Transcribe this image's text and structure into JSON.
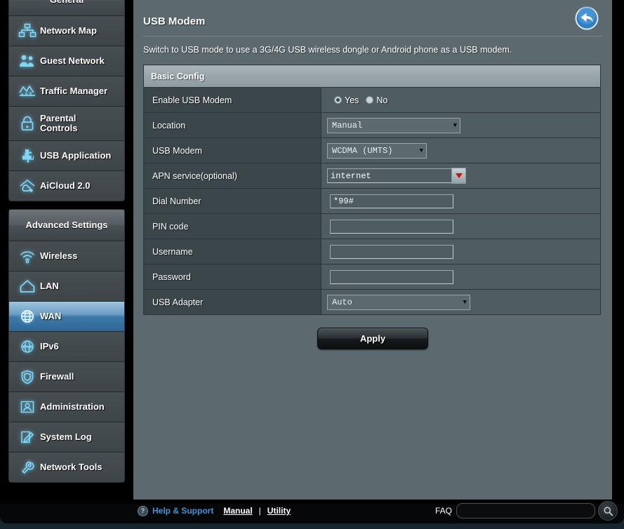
{
  "sidebar": {
    "groups": [
      {
        "title": "General",
        "items": [
          {
            "label": "Network Map",
            "icon": "network-map-icon",
            "active": false
          },
          {
            "label": "Guest Network",
            "icon": "guest-network-icon",
            "active": false
          },
          {
            "label": "Traffic Manager",
            "icon": "traffic-manager-icon",
            "active": false
          },
          {
            "label": "Parental Controls",
            "icon": "parental-controls-icon",
            "active": false
          },
          {
            "label": "USB Application",
            "icon": "usb-application-icon",
            "active": false
          },
          {
            "label": "AiCloud 2.0",
            "icon": "aicloud-icon",
            "active": false
          }
        ]
      },
      {
        "title": "Advanced Settings",
        "items": [
          {
            "label": "Wireless",
            "icon": "wireless-icon",
            "active": false
          },
          {
            "label": "LAN",
            "icon": "lan-icon",
            "active": false
          },
          {
            "label": "WAN",
            "icon": "wan-globe-icon",
            "active": true
          },
          {
            "label": "IPv6",
            "icon": "ipv6-icon",
            "active": false
          },
          {
            "label": "Firewall",
            "icon": "firewall-shield-icon",
            "active": false
          },
          {
            "label": "Administration",
            "icon": "administration-user-icon",
            "active": false
          },
          {
            "label": "System Log",
            "icon": "system-log-icon",
            "active": false
          },
          {
            "label": "Network Tools",
            "icon": "network-tools-icon",
            "active": false
          }
        ]
      }
    ]
  },
  "main": {
    "title": "USB Modem",
    "description": "Switch to USB mode to use a 3G/4G USB wireless dongle or Android phone as a USB modem.",
    "back_icon": "back-arrow-icon",
    "section_title": "Basic Config",
    "fields": {
      "enable": {
        "label": "Enable USB Modem",
        "yes_label": "Yes",
        "no_label": "No",
        "selected": "Yes"
      },
      "location": {
        "label": "Location",
        "value": "Manual"
      },
      "usb_modem": {
        "label": "USB Modem",
        "value": "WCDMA (UMTS)"
      },
      "apn": {
        "label": "APN service(optional)",
        "value": "internet"
      },
      "dial_number": {
        "label": "Dial Number",
        "value": "*99#"
      },
      "pin_code": {
        "label": "PIN code",
        "value": ""
      },
      "username": {
        "label": "Username",
        "value": ""
      },
      "password": {
        "label": "Password",
        "value": ""
      },
      "usb_adapter": {
        "label": "USB Adapter",
        "value": "Auto"
      }
    },
    "apply_label": "Apply"
  },
  "footer": {
    "help_icon": "question-mark-icon",
    "help_label": "Help & Support",
    "manual_label": "Manual",
    "separator": "|",
    "utility_label": "Utility",
    "faq_label": "FAQ",
    "faq_value": "",
    "faq_placeholder": "",
    "search_icon": "magnifier-icon"
  },
  "colors": {
    "accent_blue": "#3f93d4",
    "active_nav": "#3d7aa8",
    "panel": "#5c6a70",
    "label_cell": "#3b464b",
    "value_cell": "#4f5d63",
    "red_arrow": "#cc1111"
  }
}
